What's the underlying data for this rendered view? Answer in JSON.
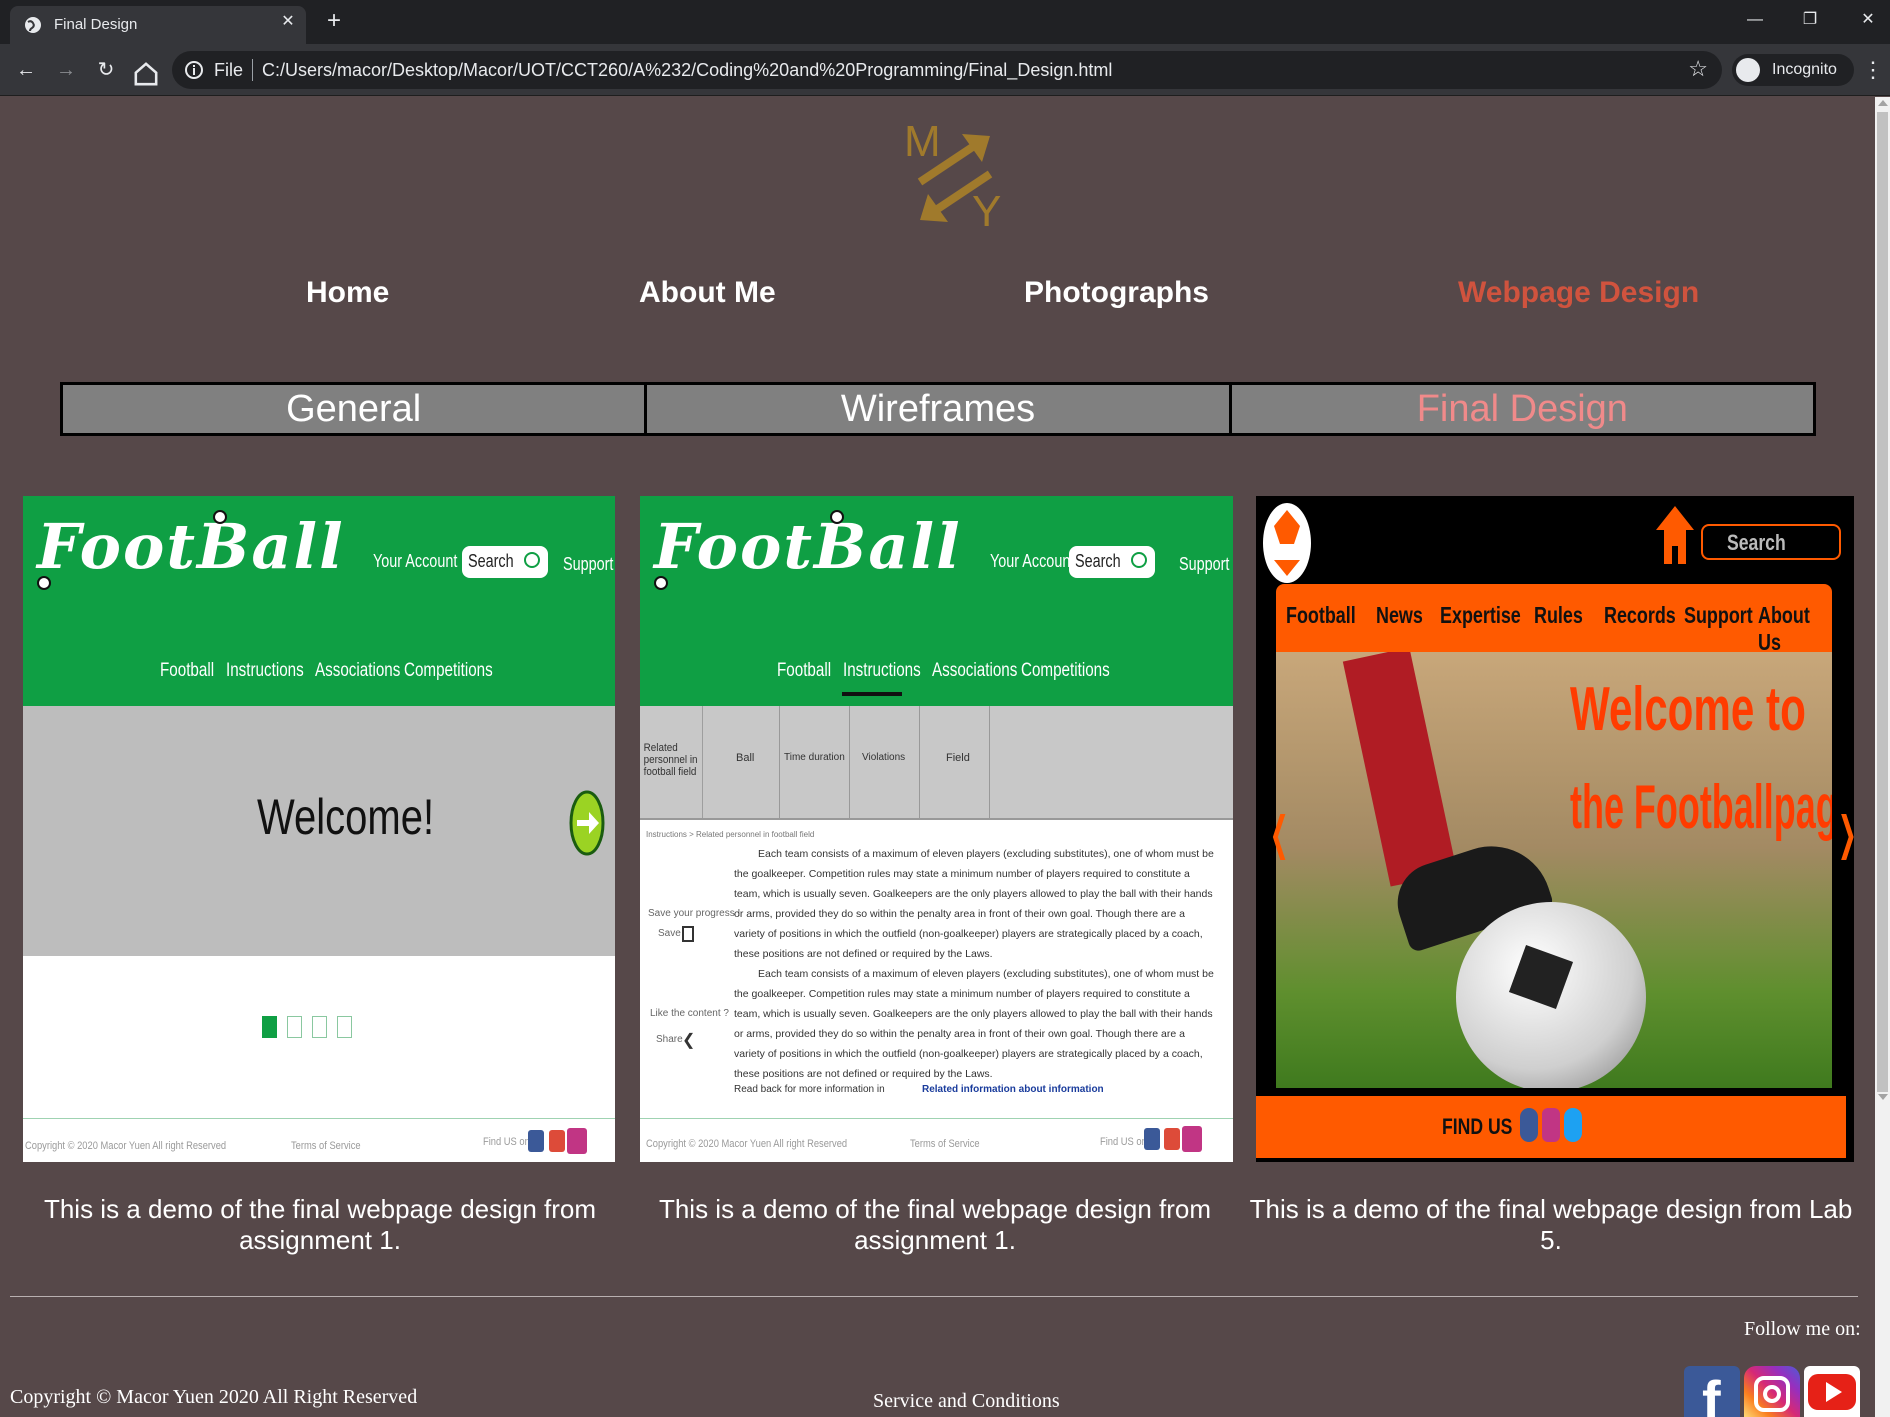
{
  "browser": {
    "tab_title": "Final Design",
    "tab_close": "✕",
    "new_tab": "+",
    "address_scheme": "File",
    "address_url": "C:/Users/macor/Desktop/Macor/UOT/CCT260/A%232/Coding%20and%20Programming/Final_Design.html",
    "profile_label": "Incognito",
    "window_min": "—",
    "window_restore": "❐",
    "window_close": "✕",
    "icons": [
      "globe-icon",
      "back-arrow-icon",
      "forward-arrow-icon",
      "reload-icon",
      "home-icon",
      "info-icon",
      "star-icon",
      "incognito-icon",
      "menu-dots-icon"
    ]
  },
  "site": {
    "logo_letters": [
      "M",
      "Y"
    ],
    "nav": [
      "Home",
      "About Me",
      "Photographs",
      "Webpage Design"
    ],
    "nav_active": "Webpage Design",
    "subnav": [
      "General",
      "Wireframes",
      "Final Design"
    ],
    "subnav_active": "Final Design"
  },
  "demo1": {
    "logo": "FootBall",
    "account": "Your Account",
    "search": "Search",
    "support": "Support",
    "menu": [
      "Football",
      "Instructions",
      "Associations",
      "Competitions"
    ],
    "welcome": "Welcome!",
    "footer_copyright": "Copyright © 2020 Macor Yuen All right Reserved",
    "footer_terms": "Terms of Service",
    "footer_find": "Find US on"
  },
  "demo2": {
    "logo": "FootBall",
    "account": "Your Account",
    "search": "Search",
    "support": "Support",
    "menu": [
      "Football",
      "Instructions",
      "Associations",
      "Competitions"
    ],
    "subtabs": [
      "Related personnel in football field",
      "Ball",
      "Time duration",
      "Violations",
      "Field"
    ],
    "breadcrumb": "Instructions > Related personnel in football field",
    "side_save_q": "Save your progress !",
    "side_save": "Save",
    "side_like_q": "Like the content ?",
    "side_share": "Share",
    "paragraph": "Each team consists of a maximum of eleven players (excluding substitutes), one of whom must be the goalkeeper. Competition rules may state a minimum number of players required to constitute a team, which is usually seven. Goalkeepers are the only players allowed to play the ball with their hands or arms, provided they do so within the penalty area in front of their own goal. Though there are a variety of positions in which the outfield (non-goalkeeper) players are strategically placed by a coach, these positions are not defined or required by the Laws.",
    "read_back": "Read back for more information in",
    "read_link": "Related information about information",
    "footer_copyright": "Copyright © 2020 Macor Yuen All right Reserved",
    "footer_terms": "Terms of Service",
    "footer_find": "Find US on"
  },
  "demo3": {
    "search": "Search",
    "menu": [
      "Football",
      "News",
      "Expertise",
      "Rules",
      "Records",
      "Support",
      "About Us"
    ],
    "hero_line1": "Welcome to",
    "hero_line2": "the Footballpage!",
    "find_us": "FIND US"
  },
  "captions": [
    "This is a demo of the final webpage design from assignment 1.",
    "This is a demo of the final webpage design from assignment 1.",
    "This is a demo of the final webpage design from Lab 5."
  ],
  "footer": {
    "copyright": "Copyright © Macor Yuen 2020 All Right Reserved",
    "service": "Service and Conditions",
    "follow": "Follow me on:",
    "social_icons": [
      "facebook-icon",
      "instagram-icon",
      "youtube-icon"
    ]
  },
  "colors": {
    "page_bg": "#564849",
    "nav_active": "#d0533e",
    "subnav_active": "#f08a8a",
    "logo_gold": "#a07a2c",
    "football_green": "#0f9f44",
    "orange": "#ff5a00"
  }
}
